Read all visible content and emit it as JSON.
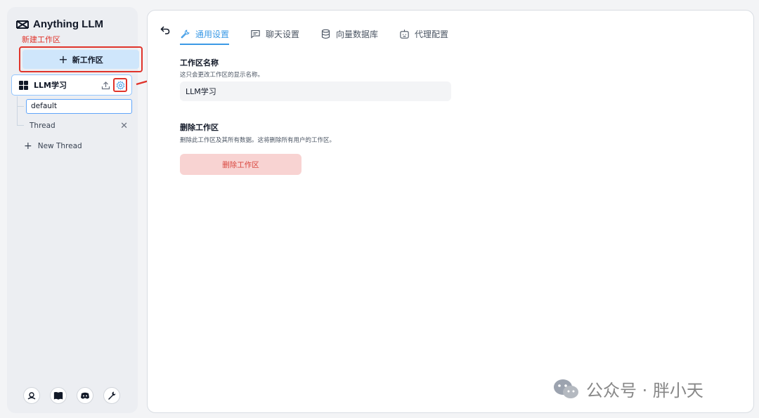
{
  "app": {
    "title": "Anything LLM"
  },
  "annotation": {
    "new_workspace_label": "新建工作区"
  },
  "sidebar": {
    "new_workspace_button": "新工作区",
    "workspace": {
      "name": "LLM学习"
    },
    "threads": [
      {
        "label": "default"
      },
      {
        "label": "Thread"
      }
    ],
    "new_thread_label": "New Thread"
  },
  "tabs": [
    {
      "label": "通用设置",
      "icon": "wrench-icon",
      "active": true
    },
    {
      "label": "聊天设置",
      "icon": "chat-icon",
      "active": false
    },
    {
      "label": "向量数据库",
      "icon": "database-icon",
      "active": false
    },
    {
      "label": "代理配置",
      "icon": "robot-icon",
      "active": false
    }
  ],
  "settings": {
    "name_section": {
      "title": "工作区名称",
      "description": "这只会更改工作区的显示名称。",
      "value": "LLM学习"
    },
    "delete_section": {
      "title": "删除工作区",
      "description": "删除此工作区及其所有数据。这将删除所有用户的工作区。",
      "button": "删除工作区"
    }
  },
  "watermark": {
    "text": "公众号 · 胖小天"
  },
  "colors": {
    "accent": "#3b9ae6",
    "annotation_red": "#e0342b",
    "delete_bg": "#f8d3d2",
    "new_button_bg": "#cfe6fb"
  }
}
